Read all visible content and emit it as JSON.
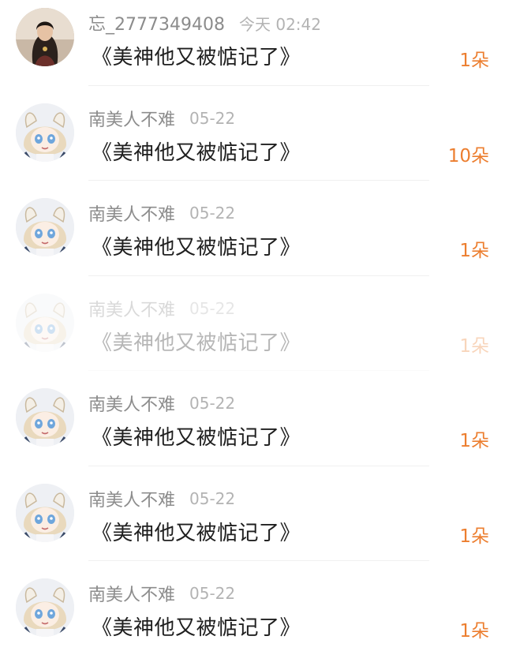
{
  "colors": {
    "accent": "#ec7e2f",
    "name": "#8c8c8c",
    "time": "#b3b3b3",
    "title": "#1f1f1f"
  },
  "gifts": [
    {
      "user": "忘_2777349408",
      "time": "今天 02:42",
      "title": "《美神他又被惦记了》",
      "count": "1朵",
      "avatar_icon": "user-avatar-icon",
      "faded": false
    },
    {
      "user": "南美人不难",
      "time": "05-22",
      "title": "《美神他又被惦记了》",
      "count": "10朵",
      "avatar_icon": "anime-avatar-icon",
      "faded": false
    },
    {
      "user": "南美人不难",
      "time": "05-22",
      "title": "《美神他又被惦记了》",
      "count": "1朵",
      "avatar_icon": "anime-avatar-icon",
      "faded": false
    },
    {
      "user": "南美人不难",
      "time": "05-22",
      "title": "《美神他又被惦记了》",
      "count": "1朵",
      "avatar_icon": "anime-avatar-icon",
      "faded": true
    },
    {
      "user": "南美人不难",
      "time": "05-22",
      "title": "《美神他又被惦记了》",
      "count": "1朵",
      "avatar_icon": "anime-avatar-icon",
      "faded": false
    },
    {
      "user": "南美人不难",
      "time": "05-22",
      "title": "《美神他又被惦记了》",
      "count": "1朵",
      "avatar_icon": "anime-avatar-icon",
      "faded": false
    },
    {
      "user": "南美人不难",
      "time": "05-22",
      "title": "《美神他又被惦记了》",
      "count": "1朵",
      "avatar_icon": "anime-avatar-icon",
      "faded": false
    }
  ]
}
